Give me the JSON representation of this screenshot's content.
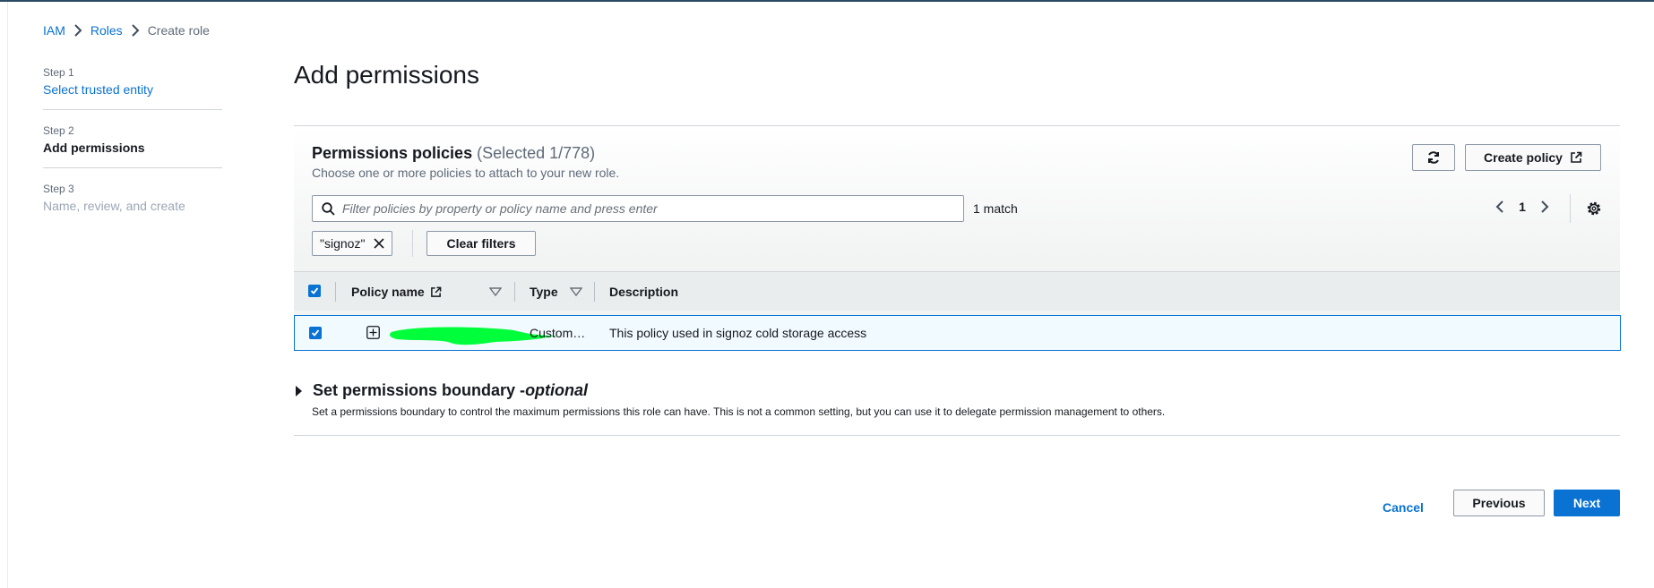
{
  "breadcrumb": {
    "items": [
      "IAM",
      "Roles"
    ],
    "current": "Create role"
  },
  "steps": [
    {
      "num": "Step 1",
      "title": "Select trusted entity"
    },
    {
      "num": "Step 2",
      "title": "Add permissions"
    },
    {
      "num": "Step 3",
      "title": "Name, review, and create"
    }
  ],
  "page_title": "Add permissions",
  "policies": {
    "title": "Permissions policies",
    "selected_count": "(Selected 1/778)",
    "description": "Choose one or more policies to attach to your new role.",
    "create_policy_label": "Create policy",
    "search_placeholder": "Filter policies by property or policy name and press enter",
    "match_text": "1 match",
    "page": "1",
    "filter_token": "\"signoz\"",
    "clear_filters_label": "Clear filters",
    "columns": {
      "name": "Policy name",
      "type": "Type",
      "description": "Description"
    },
    "rows": [
      {
        "type": "Custom…",
        "description": "This policy used in signoz cold storage access"
      }
    ]
  },
  "boundary": {
    "title": "Set permissions boundary - ",
    "title_em": "optional",
    "description": "Set a permissions boundary to control the maximum permissions this role can have. This is not a common setting, but you can use it to delegate permission management to others."
  },
  "footer": {
    "cancel": "Cancel",
    "previous": "Previous",
    "next": "Next"
  },
  "colors": {
    "accent": "#0972d3",
    "redaction": "#00ff3a"
  }
}
